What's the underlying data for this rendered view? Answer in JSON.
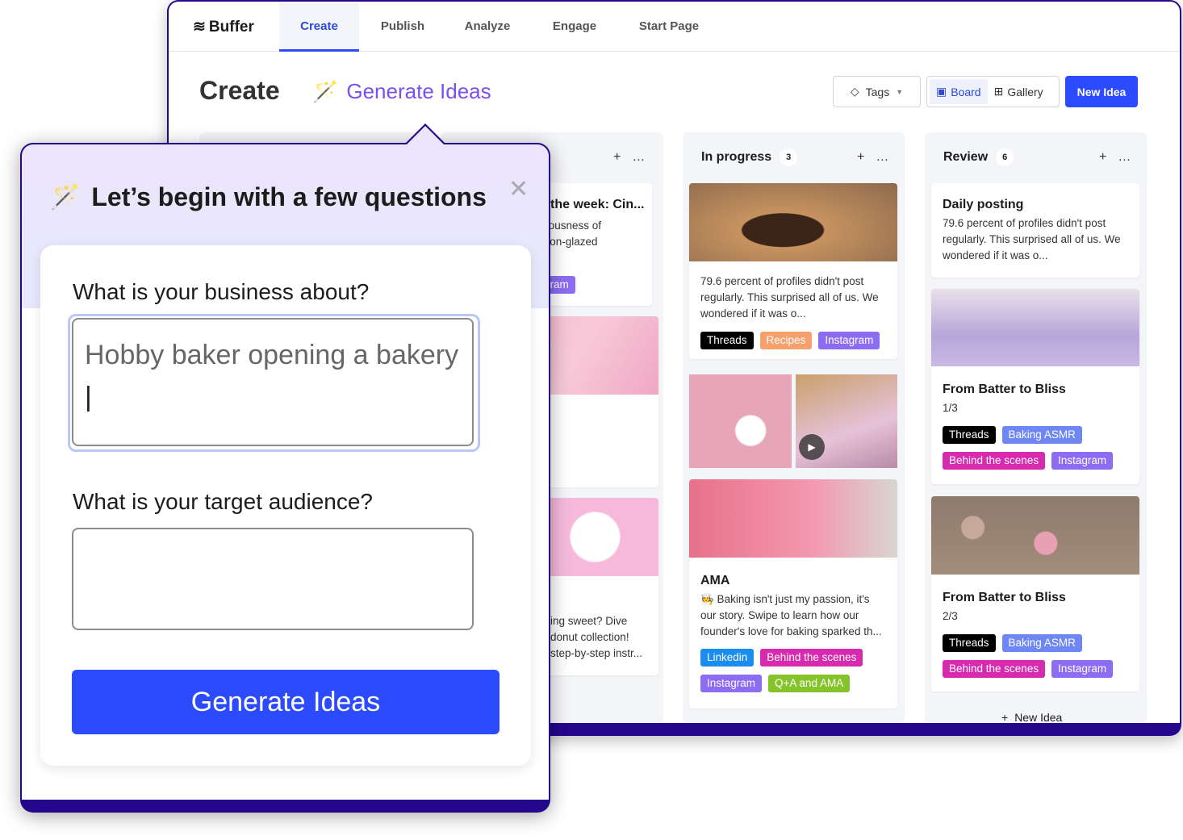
{
  "nav": {
    "logo": "Buffer",
    "tabs": [
      "Create",
      "Publish",
      "Analyze",
      "Engage",
      "Start Page"
    ],
    "active": "Create"
  },
  "header": {
    "title": "Create",
    "generate": "Generate Ideas",
    "tags": "Tags",
    "board": "Board",
    "gallery": "Gallery",
    "new_idea": "New Idea"
  },
  "col2": {
    "title_frag": "the week: Cin...",
    "line1": "ciousness of",
    "line2": "mon-glazed",
    "tag_frag": "gram",
    "b1": "ing sweet? Dive",
    "b2": "donut collection!",
    "b3": "step-by-step instr..."
  },
  "columns": [
    {
      "title": "In progress",
      "count": "3",
      "cards": [
        {
          "text": "79.6 percent of profiles didn't post regularly. This surprised all of us. We wondered if it was o...",
          "tags": [
            {
              "label": "Threads",
              "color": "#000000"
            },
            {
              "label": "Recipes",
              "color": "#f7a06b"
            },
            {
              "label": "Instagram",
              "color": "#8c6cf2"
            }
          ]
        },
        {
          "video": true
        },
        {
          "title": "AMA",
          "text": "🧑‍🍳 Baking isn't just my passion, it's our story. Swipe to learn how our founder's love for baking sparked th...",
          "tags": [
            {
              "label": "Linkedin",
              "color": "#1b8cf0"
            },
            {
              "label": "Behind the scenes",
              "color": "#d82aaf"
            },
            {
              "label": "Instagram",
              "color": "#8c6cf2"
            },
            {
              "label": "Q+A and AMA",
              "color": "#84c42a"
            }
          ]
        }
      ]
    },
    {
      "title": "Review",
      "count": "6",
      "cards": [
        {
          "title": "Daily posting",
          "text": "79.6 percent of profiles didn't post regularly. This surprised all of us. We wondered if it was o..."
        },
        {
          "title": "From Batter to Bliss",
          "sub": "1/3",
          "tags": [
            {
              "label": "Threads",
              "color": "#000000"
            },
            {
              "label": "Baking ASMR",
              "color": "#6f86f5"
            },
            {
              "label": "Behind the scenes",
              "color": "#d82aaf"
            },
            {
              "label": "Instagram",
              "color": "#8c6cf2"
            }
          ]
        },
        {
          "title": "From Batter to Bliss",
          "sub": "2/3",
          "tags": [
            {
              "label": "Threads",
              "color": "#000000"
            },
            {
              "label": "Baking ASMR",
              "color": "#6f86f5"
            },
            {
              "label": "Behind the scenes",
              "color": "#d82aaf"
            },
            {
              "label": "Instagram",
              "color": "#8c6cf2"
            }
          ]
        }
      ],
      "new_idea": "New Idea"
    }
  ],
  "modal": {
    "title": "Let’s begin with a few questions",
    "q1": "What is your business about?",
    "a1": "Hobby baker opening a bakery",
    "q2": "What is your target audience?",
    "a2": "",
    "submit": "Generate Ideas"
  },
  "colors": {
    "primary": "#2c4bff",
    "frame": "#24078c",
    "accent": "#7a4ff0"
  }
}
